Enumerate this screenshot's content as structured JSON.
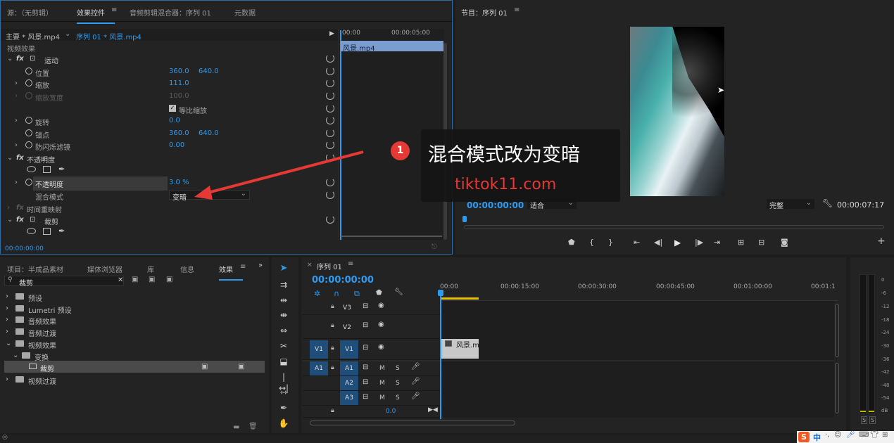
{
  "colors": {
    "accent": "#2e9bf0",
    "annotation": "#e53935",
    "panel": "#232323",
    "clip_blue": "#7a9ccf",
    "clip_gray": "#c8c8c8",
    "playhead_yellow": "#e6c100"
  },
  "source_panel": {
    "tabs": [
      "源：（无剪辑）",
      "效果控件",
      "音频剪辑混合器：序列 01",
      "元数据"
    ],
    "master_clip": "主要 * 风景.mp4",
    "sequence_clip": "序列 01 * 风景.mp4",
    "mini_ruler": [
      "00:00",
      "00:00:05:00"
    ],
    "clip_bar_label": "风景.mp4",
    "section_video_effects": "视频效果",
    "motion": {
      "label": "运动",
      "position": {
        "label": "位置",
        "x": "360.0",
        "y": "640.0"
      },
      "scale": {
        "label": "缩放",
        "value": "111.0"
      },
      "scale_width": {
        "label": "缩放宽度",
        "value": "100.0"
      },
      "uniform_scale": "等比缩放",
      "rotation": {
        "label": "旋转",
        "value": "0.0"
      },
      "anchor": {
        "label": "锚点",
        "x": "360.0",
        "y": "640.0"
      },
      "anti_flicker": {
        "label": "防闪烁滤镜",
        "value": "0.00"
      }
    },
    "opacity": {
      "label": "不透明度",
      "opacity_label": "不透明度",
      "value": "3.0 %",
      "blend_label": "混合模式",
      "blend_value": "变暗"
    },
    "time_remap": "时间重映射",
    "crop": {
      "label": "裁剪"
    },
    "timecode": "00:00:00:00"
  },
  "program_monitor": {
    "title": "节目：序列 01",
    "timecode": "00:00:00:00",
    "fit": "适合",
    "quality": "完整",
    "duration": "00:00:07:17"
  },
  "annotation": {
    "badge": "1",
    "text": "混合模式改为变暗",
    "watermark": "tiktok11.com"
  },
  "project_panel": {
    "tabs": [
      "项目：半成品素材",
      "媒体浏览器",
      "库",
      "信息",
      "效果"
    ],
    "search_value": "裁剪",
    "items": [
      {
        "label": "预设"
      },
      {
        "label": "Lumetri 预设"
      },
      {
        "label": "音频效果"
      },
      {
        "label": "音频过渡"
      },
      {
        "label": "视频效果"
      },
      {
        "label": "变换"
      },
      {
        "label": "裁剪"
      },
      {
        "label": "视频过渡"
      }
    ]
  },
  "timeline": {
    "tab": "序列 01",
    "timecode": "00:00:00:00",
    "ruler": [
      "00:00",
      "00:00:15:00",
      "00:00:30:00",
      "00:00:45:00",
      "00:01:00:00",
      "00:01:1"
    ],
    "tracks": {
      "v3": "V3",
      "v2": "V2",
      "v1": "V1",
      "a1": "A1",
      "a2": "A2",
      "a3": "A3",
      "src_v1": "V1",
      "src_a1": "A1"
    },
    "mute": "M",
    "solo": "S",
    "master_level": "0.0",
    "clip_label": "风景.m"
  },
  "meter": {
    "scale": [
      "0",
      "-6",
      "-12",
      "-18",
      "-24",
      "-30",
      "-36",
      "-42",
      "-48",
      "-54",
      "dB"
    ],
    "solo": [
      "S",
      "S"
    ]
  },
  "taskbar": {
    "ime": "中"
  }
}
